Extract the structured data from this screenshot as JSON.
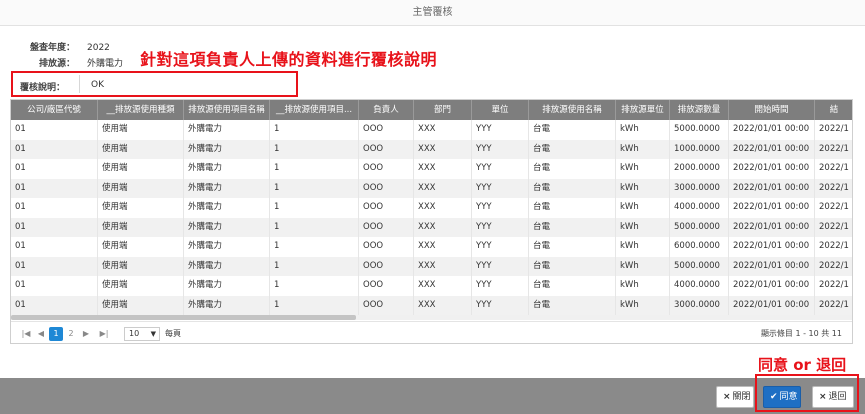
{
  "window": {
    "title": "主管覆核"
  },
  "info": {
    "year_label": "盤查年度：",
    "year_value": "2022",
    "source_label": "排放源：",
    "source_value": "外購電力"
  },
  "annotations": {
    "remark_callout": "針對這項負責人上傳的資料進行覆核說明",
    "buttons_callout": "同意 or 退回"
  },
  "remark": {
    "label": "覆核說明：",
    "value": "OK"
  },
  "table": {
    "columns": [
      "公司/廠區代號",
      "__排放源使用種類",
      "排放源使用項目名稱",
      "__排放源使用項目...",
      "負責人",
      "部門",
      "單位",
      "排放源使用名稱",
      "排放源單位",
      "排放源數量",
      "開始時間",
      "結"
    ],
    "rows": [
      [
        "01",
        "使用端",
        "外購電力",
        "1",
        "OOO",
        "XXX",
        "YYY",
        "台電",
        "kWh",
        "5000.0000",
        "2022/01/01 00:00",
        "2022/1"
      ],
      [
        "01",
        "使用端",
        "外購電力",
        "1",
        "OOO",
        "XXX",
        "YYY",
        "台電",
        "kWh",
        "1000.0000",
        "2022/01/01 00:00",
        "2022/1"
      ],
      [
        "01",
        "使用端",
        "外購電力",
        "1",
        "OOO",
        "XXX",
        "YYY",
        "台電",
        "kWh",
        "2000.0000",
        "2022/01/01 00:00",
        "2022/1"
      ],
      [
        "01",
        "使用端",
        "外購電力",
        "1",
        "OOO",
        "XXX",
        "YYY",
        "台電",
        "kWh",
        "3000.0000",
        "2022/01/01 00:00",
        "2022/1"
      ],
      [
        "01",
        "使用端",
        "外購電力",
        "1",
        "OOO",
        "XXX",
        "YYY",
        "台電",
        "kWh",
        "4000.0000",
        "2022/01/01 00:00",
        "2022/1"
      ],
      [
        "01",
        "使用端",
        "外購電力",
        "1",
        "OOO",
        "XXX",
        "YYY",
        "台電",
        "kWh",
        "5000.0000",
        "2022/01/01 00:00",
        "2022/1"
      ],
      [
        "01",
        "使用端",
        "外購電力",
        "1",
        "OOO",
        "XXX",
        "YYY",
        "台電",
        "kWh",
        "6000.0000",
        "2022/01/01 00:00",
        "2022/1"
      ],
      [
        "01",
        "使用端",
        "外購電力",
        "1",
        "OOO",
        "XXX",
        "YYY",
        "台電",
        "kWh",
        "5000.0000",
        "2022/01/01 00:00",
        "2022/1"
      ],
      [
        "01",
        "使用端",
        "外購電力",
        "1",
        "OOO",
        "XXX",
        "YYY",
        "台電",
        "kWh",
        "4000.0000",
        "2022/01/01 00:00",
        "2022/1"
      ],
      [
        "01",
        "使用端",
        "外購電力",
        "1",
        "OOO",
        "XXX",
        "YYY",
        "台電",
        "kWh",
        "3000.0000",
        "2022/01/01 00:00",
        "2022/1"
      ]
    ]
  },
  "pager": {
    "first": "|◀",
    "prev": "◀",
    "page1": "1",
    "page2": "2",
    "next": "▶",
    "last": "▶|",
    "page_size": "10",
    "per_page_label": "每頁",
    "info": "顯示條目 1 - 10 共 11"
  },
  "footer": {
    "close_icon": "×",
    "close_label": "關閉",
    "agree_icon": "✔",
    "agree_label": "同意",
    "return_icon": "×",
    "return_label": "退回"
  },
  "colors": {
    "accent": "#1e6fc4",
    "header_bg": "#7e7e7e",
    "annotation": "#e8121a"
  }
}
